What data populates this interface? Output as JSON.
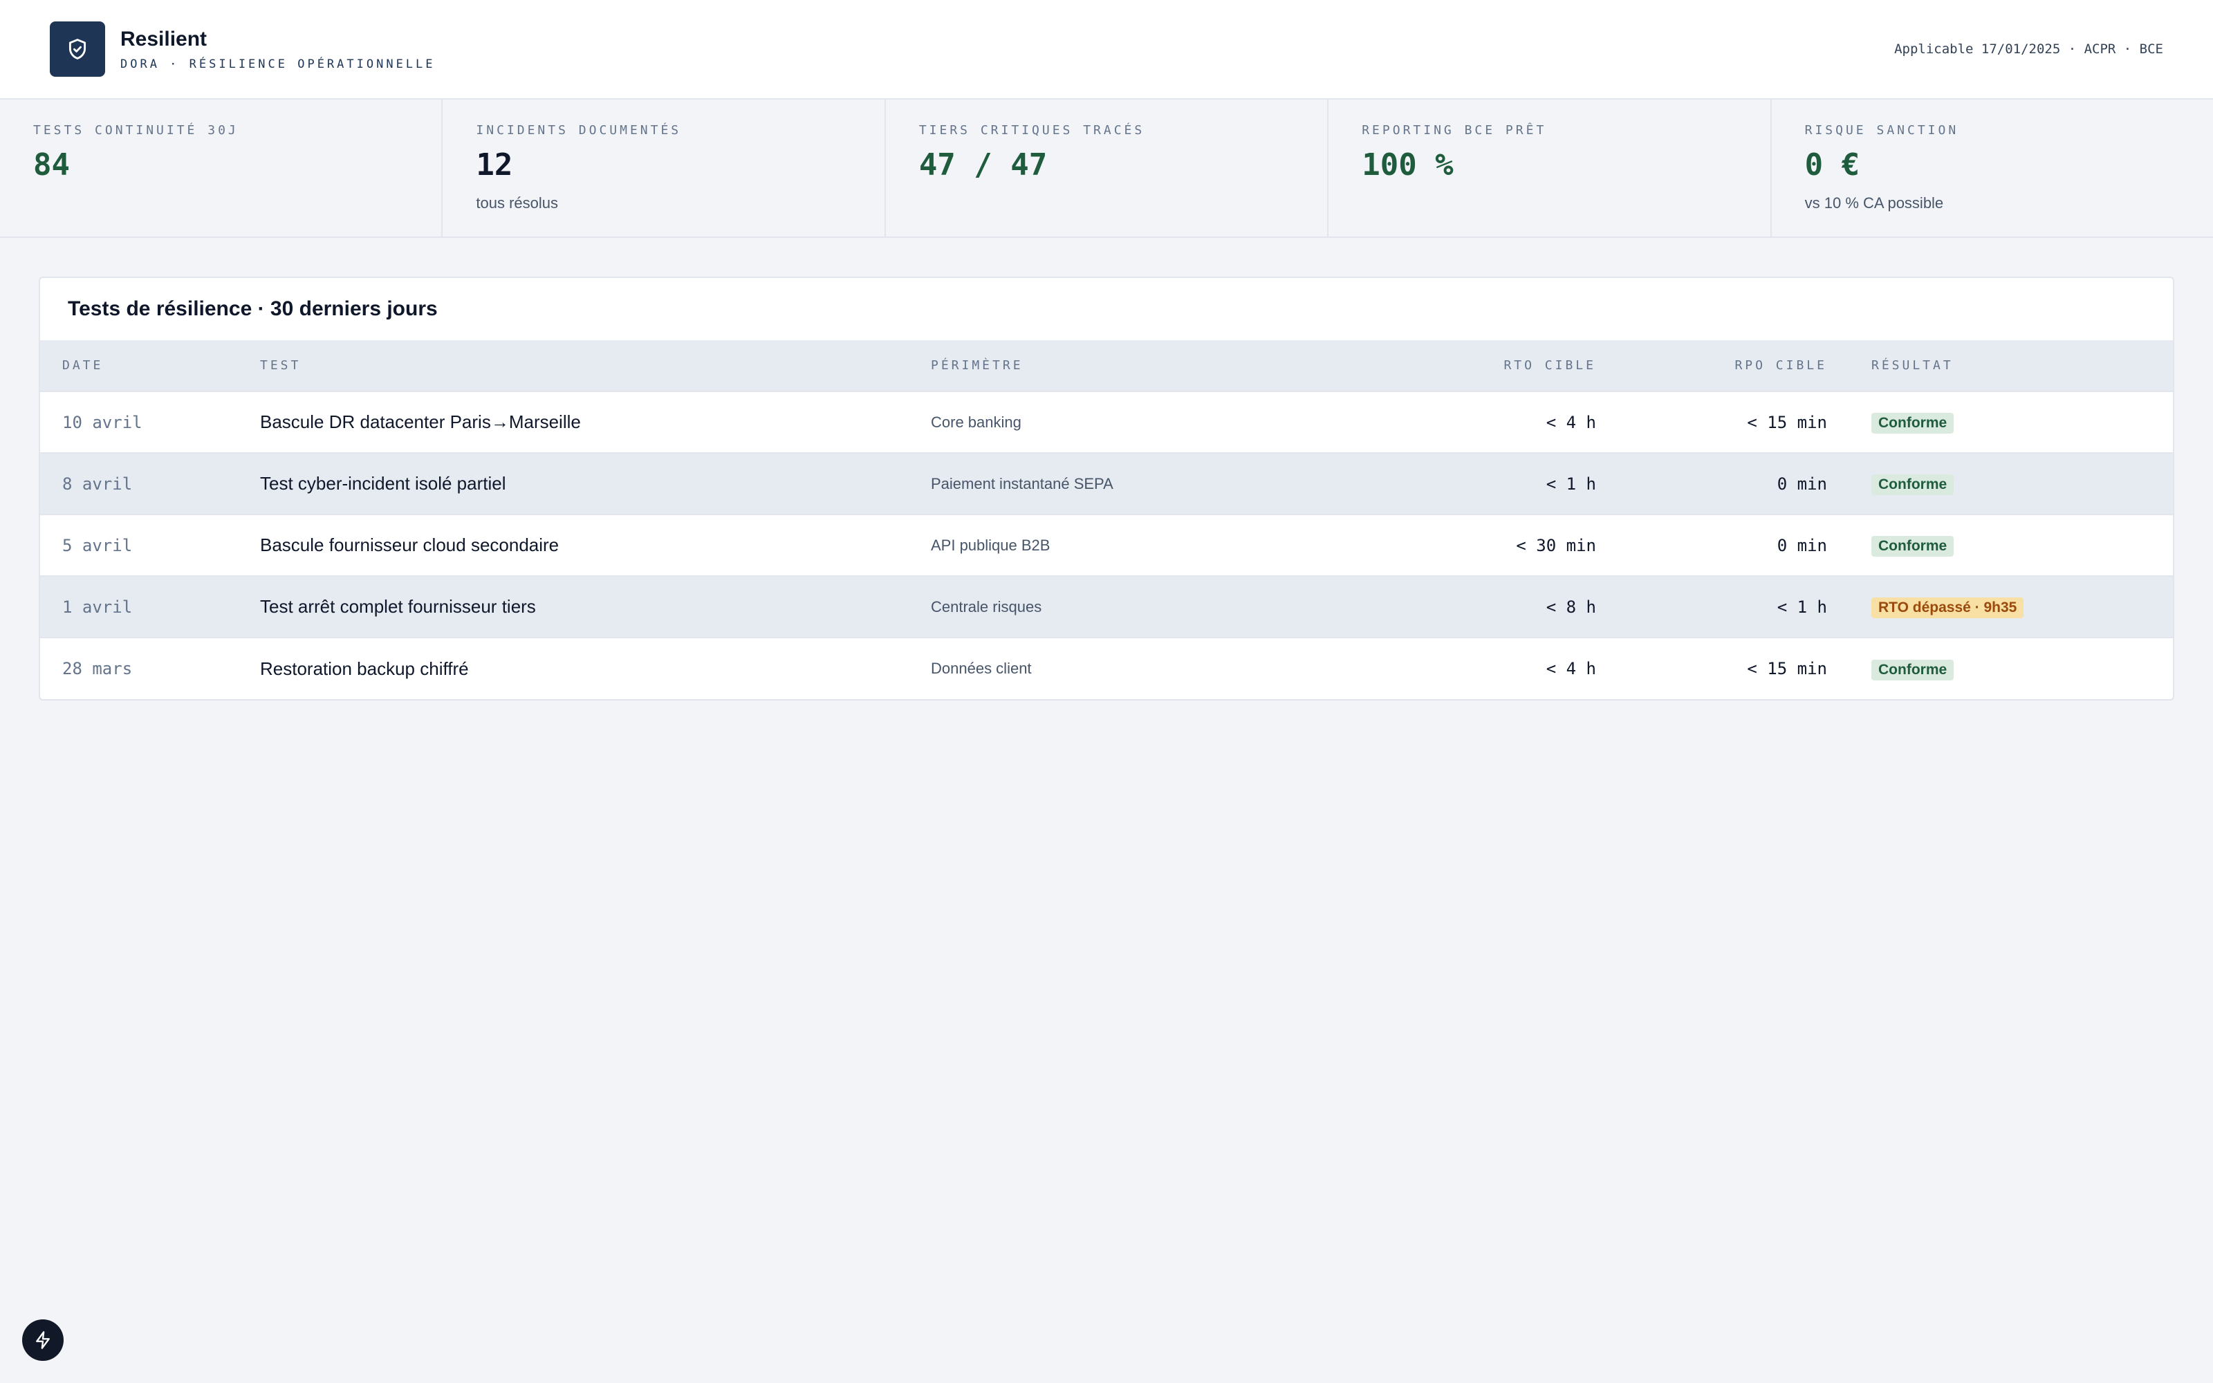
{
  "header": {
    "title": "Resilient",
    "subtitle": "DORA · RÉSILIENCE OPÉRATIONNELLE",
    "meta": "Applicable 17/01/2025 · ACPR · BCE",
    "logo_icon": "shield-check-icon"
  },
  "kpis": [
    {
      "label": "TESTS CONTINUITÉ 30J",
      "value": "84",
      "note": ""
    },
    {
      "label": "INCIDENTS DOCUMENTÉS",
      "value": "12",
      "note": "tous résolus"
    },
    {
      "label": "TIERS CRITIQUES TRACÉS",
      "value": "47 / 47",
      "note": ""
    },
    {
      "label": "REPORTING BCE PRÊT",
      "value": "100 %",
      "note": ""
    },
    {
      "label": "RISQUE SANCTION",
      "value": "0 €",
      "note": "vs 10 % CA possible"
    }
  ],
  "table": {
    "title": "Tests de résilience · 30 derniers jours",
    "columns": [
      "DATE",
      "TEST",
      "PÉRIMÈTRE",
      "RTO CIBLE",
      "RPO CIBLE",
      "RÉSULTAT"
    ],
    "rows": [
      {
        "date": "10 avril",
        "test": "Bascule DR datacenter Paris→Marseille",
        "scope": "Core banking",
        "rto": "< 4 h",
        "rpo": "< 15 min",
        "result": "Conforme",
        "status": "ok"
      },
      {
        "date": "8 avril",
        "test": "Test cyber-incident isolé partiel",
        "scope": "Paiement instantané SEPA",
        "rto": "< 1 h",
        "rpo": "0 min",
        "result": "Conforme",
        "status": "ok"
      },
      {
        "date": "5 avril",
        "test": "Bascule fournisseur cloud secondaire",
        "scope": "API publique B2B",
        "rto": "< 30 min",
        "rpo": "0 min",
        "result": "Conforme",
        "status": "ok"
      },
      {
        "date": "1 avril",
        "test": "Test arrêt complet fournisseur tiers",
        "scope": "Centrale risques",
        "rto": "< 8 h",
        "rpo": "< 1 h",
        "result": "RTO dépassé · 9h35",
        "status": "warn"
      },
      {
        "date": "28 mars",
        "test": "Restoration backup chiffré",
        "scope": "Données client",
        "rto": "< 4 h",
        "rpo": "< 15 min",
        "result": "Conforme",
        "status": "ok"
      }
    ]
  },
  "fab": {
    "icon": "lightning-icon"
  },
  "colors": {
    "navy": "#1e3556",
    "green": "#1f5c3d",
    "warn_bg": "#f8dfa4",
    "warn_fg": "#9a4a0c"
  }
}
